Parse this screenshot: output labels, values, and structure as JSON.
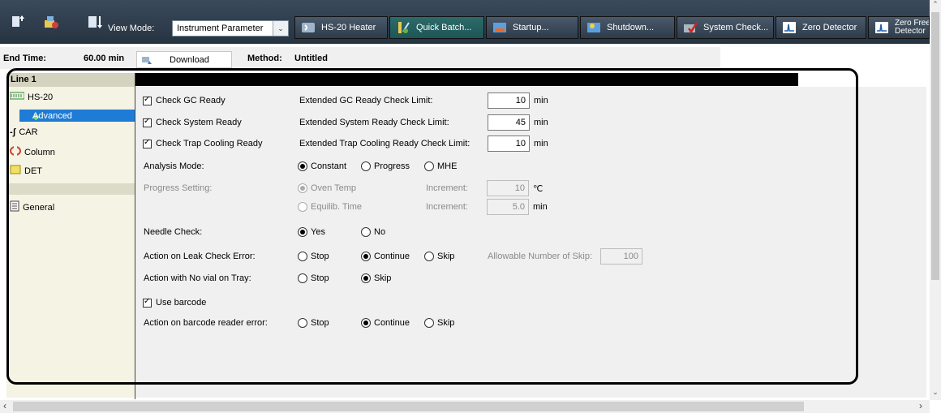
{
  "toolbar": {
    "view_mode_label": "View Mode:",
    "view_mode_value": "Instrument Parameter",
    "buttons": [
      {
        "label": "HS-20 Heater"
      },
      {
        "label": "Quick Batch..."
      },
      {
        "label": "Startup..."
      },
      {
        "label": "Shutdown..."
      },
      {
        "label": "System Check..."
      },
      {
        "label": "Zero Detector"
      },
      {
        "label_line1": "Zero Free",
        "label_line2": "Detector"
      }
    ]
  },
  "infobar": {
    "end_time_label": "End Time:",
    "end_time_value": "60.00 min",
    "download_label": "Download",
    "method_label": "Method:",
    "method_value": "Untitled"
  },
  "sidebar": {
    "line_label": "Line 1",
    "items": [
      {
        "label": "HS-20",
        "icon": "hs20-icon"
      },
      {
        "label": "Advanced",
        "icon": "diamond-icon",
        "selected": true
      },
      {
        "label": "CAR",
        "icon": "car-icon"
      },
      {
        "label": "Column",
        "icon": "column-icon"
      },
      {
        "label": "DET",
        "icon": "det-icon"
      },
      {
        "label": "General",
        "icon": "document-icon"
      }
    ]
  },
  "form": {
    "check_gc_ready": {
      "label": "Check GC Ready",
      "checked": true
    },
    "check_system_ready": {
      "label": "Check System Ready",
      "checked": true
    },
    "check_trap_ready": {
      "label": "Check Trap Cooling Ready",
      "checked": true
    },
    "ext_gc_label": "Extended GC Ready Check Limit:",
    "ext_gc_value": "10",
    "ext_sys_label": "Extended System Ready Check Limit:",
    "ext_sys_value": "45",
    "ext_trap_label": "Extended Trap Cooling Ready Check Limit:",
    "ext_trap_value": "10",
    "unit_min": "min",
    "analysis_mode_label": "Analysis Mode:",
    "analysis_modes": [
      "Constant",
      "Progress",
      "MHE"
    ],
    "analysis_mode_selected": "Constant",
    "progress_setting_label": "Progress Setting:",
    "oven_temp_label": "Oven Temp",
    "equilib_time_label": "Equilib. Time",
    "increment_label": "Increment:",
    "increment_temp_value": "10",
    "increment_temp_unit": "℃",
    "increment_time_value": "5.0",
    "needle_check_label": "Needle Check:",
    "yes_label": "Yes",
    "no_label": "No",
    "leak_error_label": "Action on Leak Check Error:",
    "stop_label": "Stop",
    "continue_label": "Continue",
    "skip_label": "Skip",
    "allow_skip_label": "Allowable Number of Skip:",
    "allow_skip_value": "100",
    "no_vial_label": "Action with No vial on Tray:",
    "use_barcode_label": "Use barcode",
    "use_barcode_checked": true,
    "barcode_error_label": "Action on barcode reader error:"
  },
  "colors": {
    "toolbar_bg": "#2e3b49",
    "selected_item": "#1e7bd6",
    "sidebar_bg": "#f4f3e4"
  }
}
